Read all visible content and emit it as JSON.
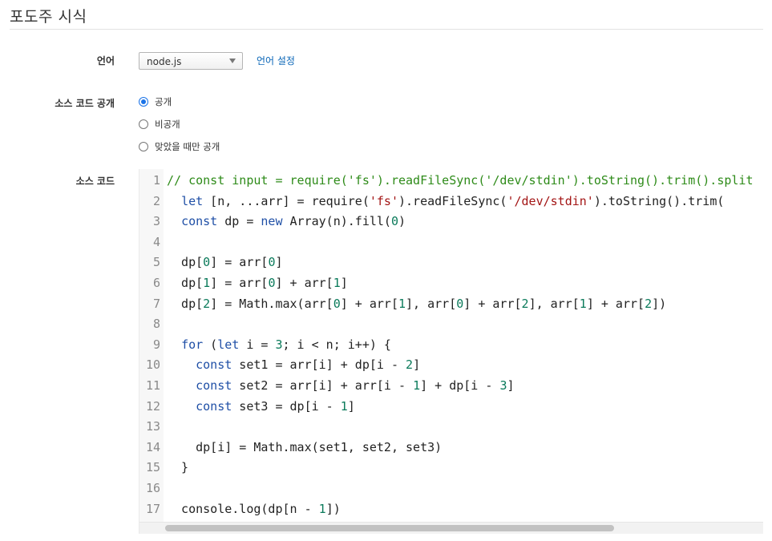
{
  "page": {
    "title": "포도주 시식"
  },
  "form": {
    "language_label": "언어",
    "language_selected": "node.js",
    "language_settings_link": "언어 설정",
    "visibility_label": "소스 코드 공개",
    "visibility_options": [
      "공개",
      "비공개",
      "맞았을 때만 공개"
    ],
    "visibility_selected_index": 0,
    "source_label": "소스 코드"
  },
  "editor": {
    "line_numbers": [
      "1",
      "2",
      "3",
      "4",
      "5",
      "6",
      "7",
      "8",
      "9",
      "10",
      "11",
      "12",
      "13",
      "14",
      "15",
      "16",
      "17"
    ],
    "lines": [
      "// const input = require('fs').readFileSync('/dev/stdin').toString().trim().split",
      "  let [n, ...arr] = require('fs').readFileSync('/dev/stdin').toString().trim(",
      "  const dp = new Array(n).fill(0)",
      "",
      "  dp[0] = arr[0]",
      "  dp[1] = arr[0] + arr[1]",
      "  dp[2] = Math.max(arr[0] + arr[1], arr[0] + arr[2], arr[1] + arr[2])",
      "",
      "  for (let i = 3; i < n; i++) {",
      "    const set1 = arr[i] + dp[i - 2]",
      "    const set2 = arr[i] + arr[i - 1] + dp[i - 3]",
      "    const set3 = dp[i - 1]",
      "",
      "    dp[i] = Math.max(set1, set2, set3)",
      "  }",
      "",
      "  console.log(dp[n - 1])"
    ]
  },
  "colors": {
    "comment": "#2e8b19",
    "keyword": "#1f4fa6",
    "string": "#a31515",
    "number": "#0a7a5a",
    "link": "#0a66b7",
    "radio_accent": "#1a73e8"
  }
}
